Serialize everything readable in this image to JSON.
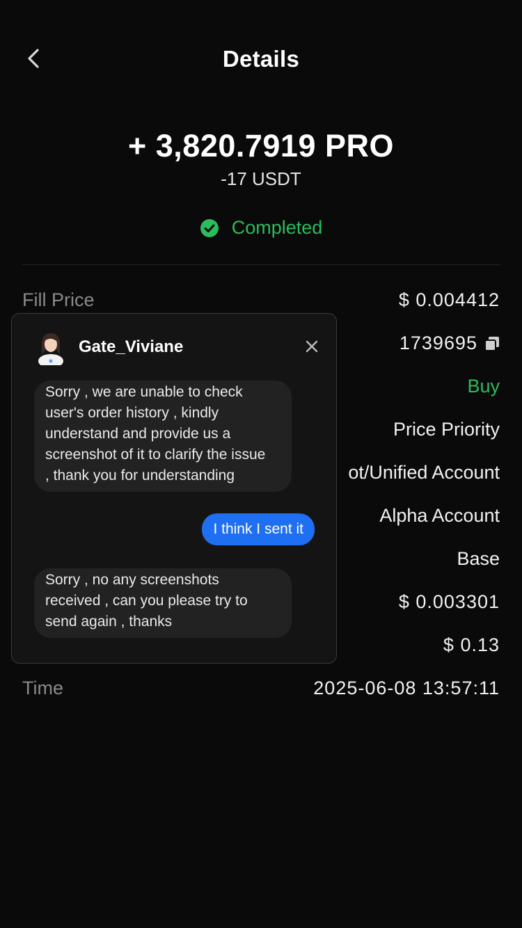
{
  "header": {
    "title": "Details"
  },
  "summary": {
    "amount": "+ 3,820.7919 PRO",
    "sub_amount": "-17 USDT",
    "status": "Completed",
    "status_color": "#2bbd5c"
  },
  "details": {
    "fill_price": {
      "label": "Fill Price",
      "value": "$ 0.004412"
    },
    "order_id": {
      "value": "1739695"
    },
    "side": {
      "value": "Buy"
    },
    "order_type": {
      "value": "Price Priority"
    },
    "account": {
      "value": "ot/Unified Account"
    },
    "sub_account": {
      "value": "Alpha Account"
    },
    "chain": {
      "value": "Base"
    },
    "fee_price": {
      "value": "$ 0.003301"
    },
    "fee": {
      "value": "$ 0.13"
    },
    "time": {
      "label": "Time",
      "value": "2025-06-08 13:57:11"
    }
  },
  "chat": {
    "agent_name": "Gate_Viviane",
    "messages": [
      {
        "from": "agent",
        "lines": [
          "Sorry , we are unable to check",
          "user's order history , kindly",
          "understand and provide us a",
          "screenshot of it to clarify the issue",
          ", thank you for understanding"
        ]
      },
      {
        "from": "user",
        "text": "I think I sent it",
        "color": "#1f6ff2"
      },
      {
        "from": "agent",
        "lines": [
          "Sorry , no any screenshots",
          "received , can you please try to",
          "send again , thanks"
        ]
      }
    ]
  },
  "icons": {
    "back": "chevron-left-icon",
    "status": "check-circle-icon",
    "copy": "copy-icon",
    "close": "close-icon"
  }
}
